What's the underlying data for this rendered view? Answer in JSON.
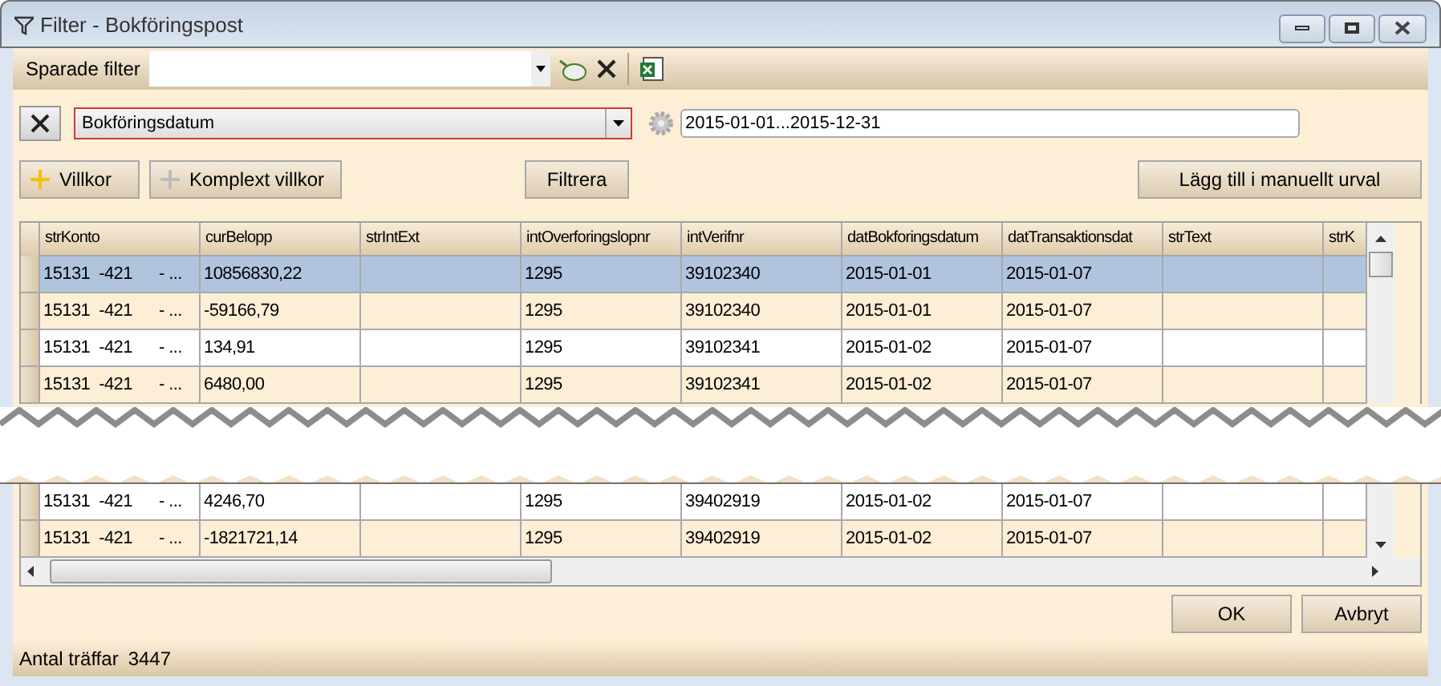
{
  "window": {
    "title": "Filter - Bokföringspost"
  },
  "toolbar": {
    "label": "Sparade filter"
  },
  "condition": {
    "field": "Bokföringsdatum",
    "value": "2015-01-01...2015-12-31"
  },
  "buttons": {
    "add_condition": "Villkor",
    "add_complex": "Komplext villkor",
    "filter": "Filtrera",
    "add_manual": "Lägg till i manuellt urval",
    "ok": "OK",
    "cancel": "Avbryt"
  },
  "table": {
    "columns": [
      "strKonto",
      "curBelopp",
      "strIntExt",
      "intOverforingslopnr",
      "intVerifnr",
      "datBokforingsdatum",
      "datTransaktionsdat",
      "strText",
      "strK"
    ],
    "rows": [
      {
        "selected": true,
        "cells": [
          "15131  -421      - ...",
          "10856830,22",
          "",
          "1295",
          "39102340",
          "2015-01-01",
          "2015-01-07",
          "",
          ""
        ]
      },
      {
        "selected": false,
        "cells": [
          "15131  -421      - ...",
          "-59166,79",
          "",
          "1295",
          "39102340",
          "2015-01-01",
          "2015-01-07",
          "",
          ""
        ]
      },
      {
        "selected": false,
        "cells": [
          "15131  -421      - ...",
          "134,91",
          "",
          "1295",
          "39102341",
          "2015-01-02",
          "2015-01-07",
          "",
          ""
        ]
      },
      {
        "selected": false,
        "cells": [
          "15131  -421      - ...",
          "6480,00",
          "",
          "1295",
          "39102341",
          "2015-01-02",
          "2015-01-07",
          "",
          ""
        ]
      }
    ],
    "rows_after_break": [
      {
        "selected": false,
        "cells": [
          "15131  -421      - ...",
          "4246,70",
          "",
          "1295",
          "39402919",
          "2015-01-02",
          "2015-01-07",
          "",
          ""
        ]
      },
      {
        "selected": false,
        "cells": [
          "15131  -421      - ...",
          "-1821721,14",
          "",
          "1295",
          "39402919",
          "2015-01-02",
          "2015-01-07",
          "",
          ""
        ]
      }
    ]
  },
  "status_bar": {
    "label": "Antal träffar",
    "count": "3447"
  }
}
